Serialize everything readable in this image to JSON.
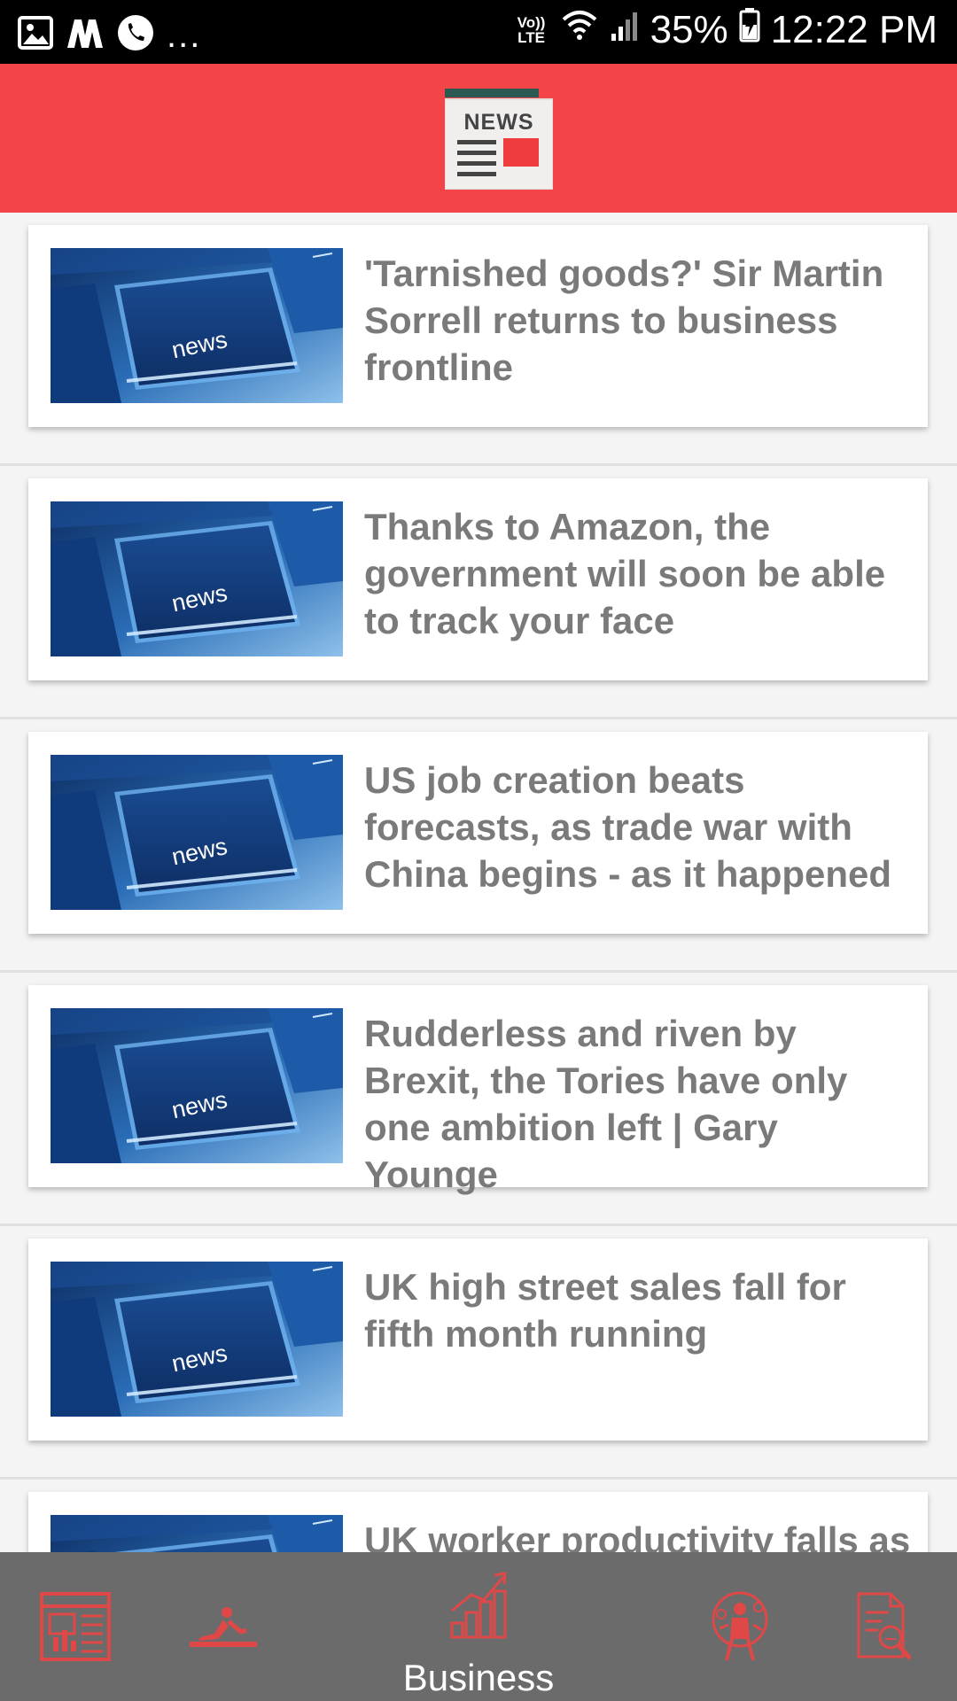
{
  "status_bar": {
    "left_icons": [
      "image-icon",
      "m-app-icon",
      "phone-icon"
    ],
    "overflow": "...",
    "volte": "Vo)) LTE",
    "battery_percent": "35%",
    "time": "12:22 PM"
  },
  "header": {
    "logo_text": "NEWS"
  },
  "thumbnail_key_text": "news",
  "articles": [
    {
      "title": "'Tarnished goods?' Sir Martin Sorrell returns to business frontline"
    },
    {
      "title": "Thanks to Amazon, the government will soon be able to track your face"
    },
    {
      "title": "US job creation beats forecasts, as trade war with China begins - as it happened"
    },
    {
      "title": "Rudderless and riven by Brexit, the Tories have only one ambition left | Gary Younge"
    },
    {
      "title": "UK high street sales fall for fifth month running"
    },
    {
      "title": "UK worker productivity falls as"
    }
  ],
  "bottom_nav": {
    "items": [
      {
        "icon": "newspaper-icon",
        "label": ""
      },
      {
        "icon": "relax-person-icon",
        "label": ""
      },
      {
        "icon": "bar-chart-growth-icon",
        "label": "Business"
      },
      {
        "icon": "science-person-icon",
        "label": ""
      },
      {
        "icon": "document-search-icon",
        "label": ""
      }
    ],
    "active_index": 2
  },
  "colors": {
    "accent": "#f34447",
    "nav_background": "#6b6b6b",
    "headline_text": "#7a7a7a",
    "status_bar": "#000000"
  }
}
